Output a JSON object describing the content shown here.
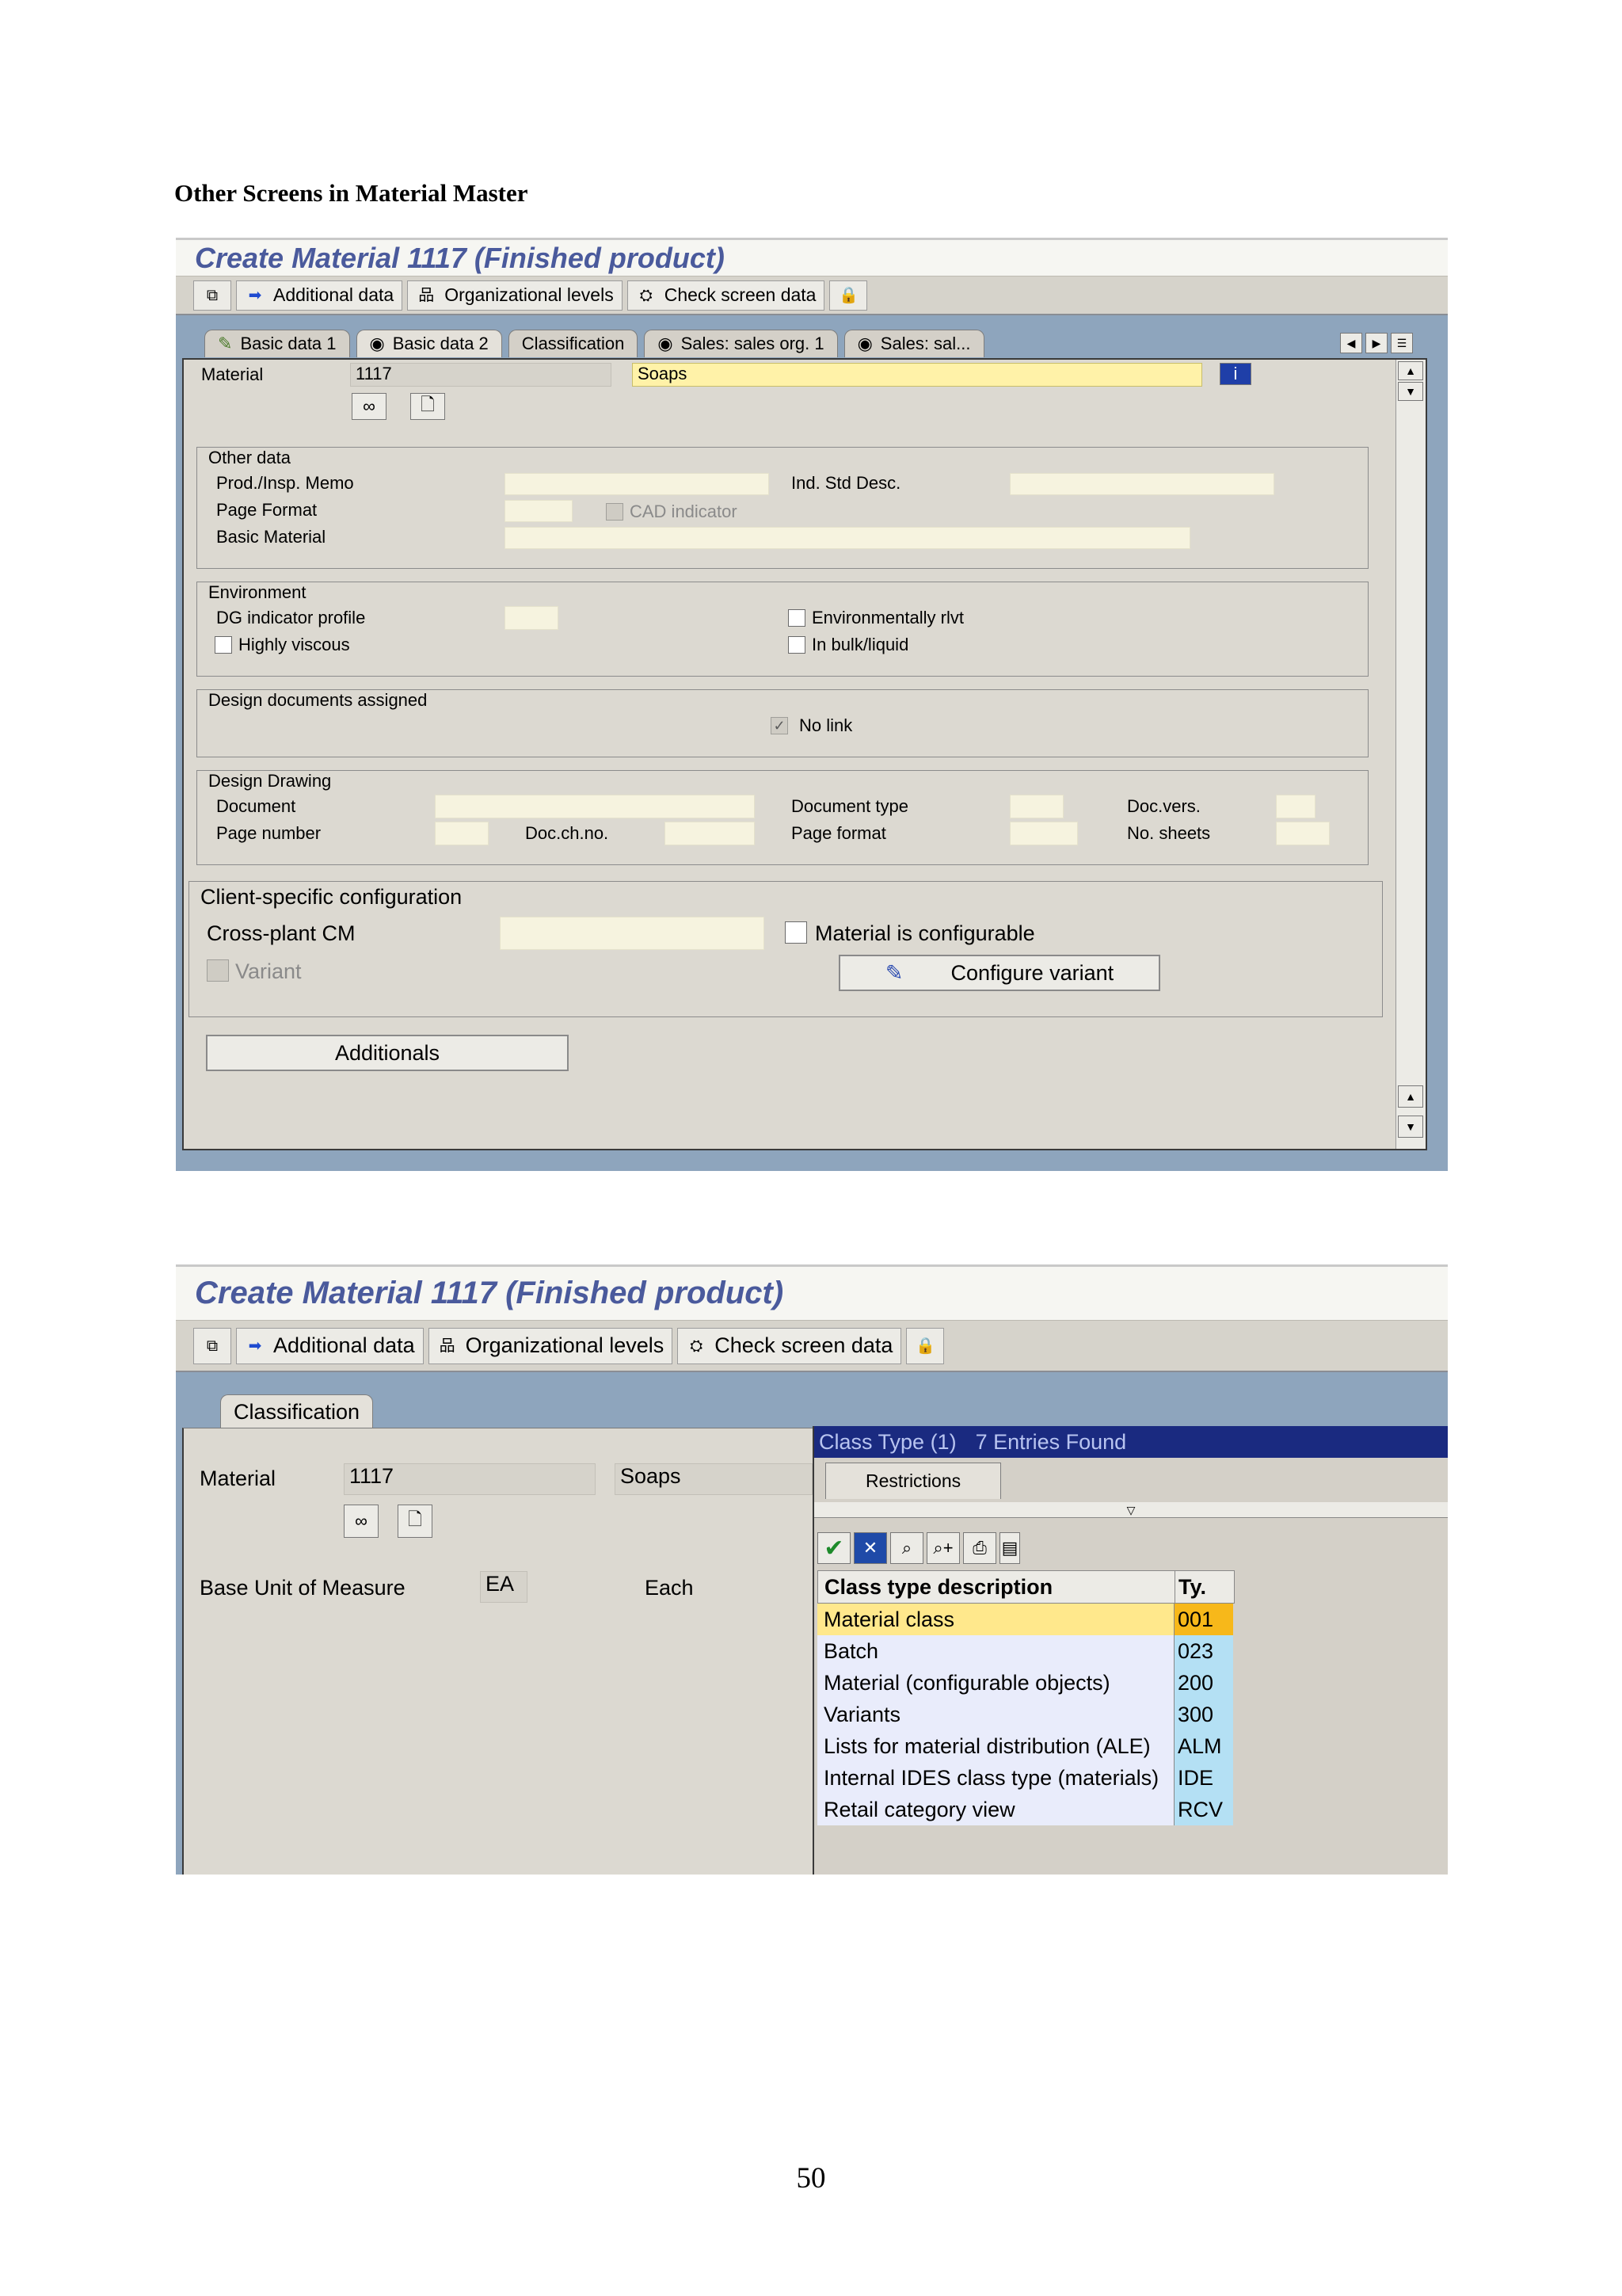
{
  "heading": "Other Screens in Material Master",
  "page_number": "50",
  "screen1": {
    "title": "Create Material 1117 (Finished product)",
    "toolbar": [
      "Additional data",
      "Organizational levels",
      "Check screen data"
    ],
    "tabs": [
      "Basic data 1",
      "Basic data 2",
      "Classification",
      "Sales: sales org. 1",
      "Sales: sal..."
    ],
    "material_label": "Material",
    "material_number": "1117",
    "material_desc": "Soaps",
    "other_data": {
      "title": "Other data",
      "prod_insp_memo": "Prod./Insp. Memo",
      "ind_std_desc": "Ind. Std Desc.",
      "page_format": "Page Format",
      "cad_indicator": "CAD indicator",
      "basic_material": "Basic Material"
    },
    "environment": {
      "title": "Environment",
      "dg_indicator": "DG indicator profile",
      "env_relevant": "Environmentally rlvt",
      "highly_viscous": "Highly viscous",
      "in_bulk": "In bulk/liquid"
    },
    "design_docs": {
      "title": "Design documents assigned",
      "no_link": "No link"
    },
    "design_drawing": {
      "title": "Design Drawing",
      "document": "Document",
      "document_type": "Document type",
      "doc_vers": "Doc.vers.",
      "page_number": "Page number",
      "doc_ch_no": "Doc.ch.no.",
      "page_format": "Page format",
      "no_sheets": "No. sheets"
    },
    "client_config": {
      "title": "Client-specific configuration",
      "cross_plant": "Cross-plant CM",
      "material_configurable": "Material is configurable",
      "variant": "Variant",
      "configure_variant": "Configure variant"
    },
    "additionals": "Additionals"
  },
  "screen2": {
    "title": "Create Material 1117 (Finished product)",
    "toolbar": [
      "Additional data",
      "Organizational levels",
      "Check screen data"
    ],
    "tab": "Classification",
    "material_label": "Material",
    "material_number": "1117",
    "material_desc": "Soaps",
    "base_unit_label": "Base Unit of Measure",
    "base_unit_value": "EA",
    "base_unit_text": "Each",
    "popup": {
      "title": "Class Type (1)",
      "entries_found": "7 Entries Found",
      "restrictions_tab": "Restrictions",
      "col_desc": "Class type description",
      "col_ty": "Ty.",
      "rows": [
        {
          "desc": "Material class",
          "ty": "001"
        },
        {
          "desc": "Batch",
          "ty": "023"
        },
        {
          "desc": "Material (configurable objects)",
          "ty": "200"
        },
        {
          "desc": "Variants",
          "ty": "300"
        },
        {
          "desc": "Lists for material distribution (ALE)",
          "ty": "ALM"
        },
        {
          "desc": "Internal IDES class type (materials)",
          "ty": "IDE"
        },
        {
          "desc": "Retail category view",
          "ty": "RCV"
        }
      ]
    }
  }
}
